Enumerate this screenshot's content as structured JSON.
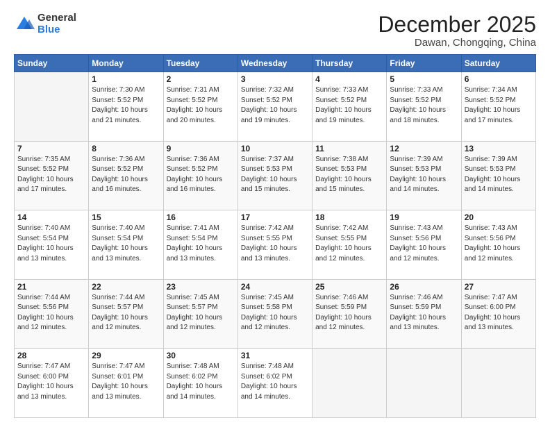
{
  "logo": {
    "general": "General",
    "blue": "Blue"
  },
  "header": {
    "month_year": "December 2025",
    "location": "Dawan, Chongqing, China"
  },
  "weekdays": [
    "Sunday",
    "Monday",
    "Tuesday",
    "Wednesday",
    "Thursday",
    "Friday",
    "Saturday"
  ],
  "weeks": [
    [
      {
        "day": "",
        "info": ""
      },
      {
        "day": "1",
        "info": "Sunrise: 7:30 AM\nSunset: 5:52 PM\nDaylight: 10 hours\nand 21 minutes."
      },
      {
        "day": "2",
        "info": "Sunrise: 7:31 AM\nSunset: 5:52 PM\nDaylight: 10 hours\nand 20 minutes."
      },
      {
        "day": "3",
        "info": "Sunrise: 7:32 AM\nSunset: 5:52 PM\nDaylight: 10 hours\nand 19 minutes."
      },
      {
        "day": "4",
        "info": "Sunrise: 7:33 AM\nSunset: 5:52 PM\nDaylight: 10 hours\nand 19 minutes."
      },
      {
        "day": "5",
        "info": "Sunrise: 7:33 AM\nSunset: 5:52 PM\nDaylight: 10 hours\nand 18 minutes."
      },
      {
        "day": "6",
        "info": "Sunrise: 7:34 AM\nSunset: 5:52 PM\nDaylight: 10 hours\nand 17 minutes."
      }
    ],
    [
      {
        "day": "7",
        "info": "Sunrise: 7:35 AM\nSunset: 5:52 PM\nDaylight: 10 hours\nand 17 minutes."
      },
      {
        "day": "8",
        "info": "Sunrise: 7:36 AM\nSunset: 5:52 PM\nDaylight: 10 hours\nand 16 minutes."
      },
      {
        "day": "9",
        "info": "Sunrise: 7:36 AM\nSunset: 5:52 PM\nDaylight: 10 hours\nand 16 minutes."
      },
      {
        "day": "10",
        "info": "Sunrise: 7:37 AM\nSunset: 5:53 PM\nDaylight: 10 hours\nand 15 minutes."
      },
      {
        "day": "11",
        "info": "Sunrise: 7:38 AM\nSunset: 5:53 PM\nDaylight: 10 hours\nand 15 minutes."
      },
      {
        "day": "12",
        "info": "Sunrise: 7:39 AM\nSunset: 5:53 PM\nDaylight: 10 hours\nand 14 minutes."
      },
      {
        "day": "13",
        "info": "Sunrise: 7:39 AM\nSunset: 5:53 PM\nDaylight: 10 hours\nand 14 minutes."
      }
    ],
    [
      {
        "day": "14",
        "info": "Sunrise: 7:40 AM\nSunset: 5:54 PM\nDaylight: 10 hours\nand 13 minutes."
      },
      {
        "day": "15",
        "info": "Sunrise: 7:40 AM\nSunset: 5:54 PM\nDaylight: 10 hours\nand 13 minutes."
      },
      {
        "day": "16",
        "info": "Sunrise: 7:41 AM\nSunset: 5:54 PM\nDaylight: 10 hours\nand 13 minutes."
      },
      {
        "day": "17",
        "info": "Sunrise: 7:42 AM\nSunset: 5:55 PM\nDaylight: 10 hours\nand 13 minutes."
      },
      {
        "day": "18",
        "info": "Sunrise: 7:42 AM\nSunset: 5:55 PM\nDaylight: 10 hours\nand 12 minutes."
      },
      {
        "day": "19",
        "info": "Sunrise: 7:43 AM\nSunset: 5:56 PM\nDaylight: 10 hours\nand 12 minutes."
      },
      {
        "day": "20",
        "info": "Sunrise: 7:43 AM\nSunset: 5:56 PM\nDaylight: 10 hours\nand 12 minutes."
      }
    ],
    [
      {
        "day": "21",
        "info": "Sunrise: 7:44 AM\nSunset: 5:56 PM\nDaylight: 10 hours\nand 12 minutes."
      },
      {
        "day": "22",
        "info": "Sunrise: 7:44 AM\nSunset: 5:57 PM\nDaylight: 10 hours\nand 12 minutes."
      },
      {
        "day": "23",
        "info": "Sunrise: 7:45 AM\nSunset: 5:57 PM\nDaylight: 10 hours\nand 12 minutes."
      },
      {
        "day": "24",
        "info": "Sunrise: 7:45 AM\nSunset: 5:58 PM\nDaylight: 10 hours\nand 12 minutes."
      },
      {
        "day": "25",
        "info": "Sunrise: 7:46 AM\nSunset: 5:59 PM\nDaylight: 10 hours\nand 12 minutes."
      },
      {
        "day": "26",
        "info": "Sunrise: 7:46 AM\nSunset: 5:59 PM\nDaylight: 10 hours\nand 13 minutes."
      },
      {
        "day": "27",
        "info": "Sunrise: 7:47 AM\nSunset: 6:00 PM\nDaylight: 10 hours\nand 13 minutes."
      }
    ],
    [
      {
        "day": "28",
        "info": "Sunrise: 7:47 AM\nSunset: 6:00 PM\nDaylight: 10 hours\nand 13 minutes."
      },
      {
        "day": "29",
        "info": "Sunrise: 7:47 AM\nSunset: 6:01 PM\nDaylight: 10 hours\nand 13 minutes."
      },
      {
        "day": "30",
        "info": "Sunrise: 7:48 AM\nSunset: 6:02 PM\nDaylight: 10 hours\nand 14 minutes."
      },
      {
        "day": "31",
        "info": "Sunrise: 7:48 AM\nSunset: 6:02 PM\nDaylight: 10 hours\nand 14 minutes."
      },
      {
        "day": "",
        "info": ""
      },
      {
        "day": "",
        "info": ""
      },
      {
        "day": "",
        "info": ""
      }
    ]
  ]
}
